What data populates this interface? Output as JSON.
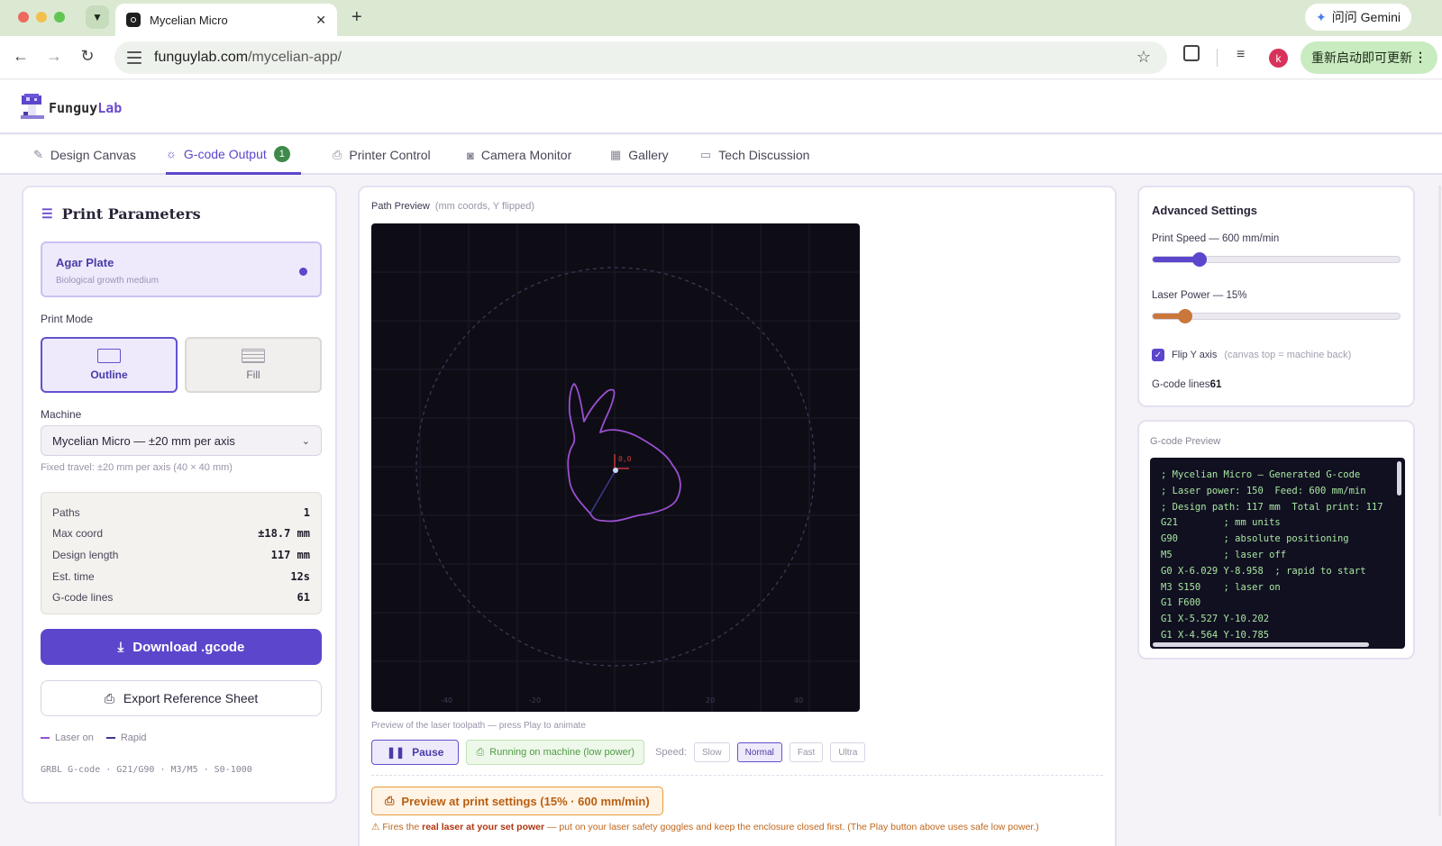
{
  "browser": {
    "tab_title": "Mycelian Micro",
    "url_host": "funguylab.com",
    "url_path": "/mycelian-app/",
    "gemini_label": "问问 Gemini",
    "avatar_letter": "k",
    "update_label": "重新启动即可更新"
  },
  "app": {
    "logo_main": "Funguy",
    "logo_accent": "Lab",
    "tabs": [
      {
        "label": "Design Canvas",
        "icon": "pencil-icon"
      },
      {
        "label": "G-code Output",
        "icon": "sun-icon",
        "badge": "1"
      },
      {
        "label": "Printer Control",
        "icon": "printer-icon"
      },
      {
        "label": "Camera Monitor",
        "icon": "camera-icon"
      },
      {
        "label": "Gallery",
        "icon": "grid-icon"
      },
      {
        "label": "Tech Discussion",
        "icon": "chat-icon"
      }
    ]
  },
  "params": {
    "title": "Print Parameters",
    "material_name": "Agar Plate",
    "material_sub": "Biological growth medium",
    "print_mode_label": "Print Mode",
    "mode_outline": "Outline",
    "mode_fill": "Fill",
    "machine_label": "Machine",
    "machine_value": "Mycelian Micro — ±20 mm per axis",
    "fixed_travel": "Fixed travel: ±20 mm per axis (40 × 40 mm)",
    "stats": [
      {
        "label": "Paths",
        "value": "1",
        "unit": ""
      },
      {
        "label": "Max coord",
        "value": "±18.7",
        "unit": "mm"
      },
      {
        "label": "Design length",
        "value": "117",
        "unit": "mm"
      },
      {
        "label": "Est. time",
        "value": "12s",
        "unit": ""
      },
      {
        "label": "G-code lines",
        "value": "61",
        "unit": ""
      }
    ],
    "download_label": "Download .gcode",
    "export_label": "Export Reference Sheet",
    "legend_laser": "Laser on",
    "legend_rapid": "Rapid",
    "footer": "GRBL G-code · G21/G90 · M3/M5 · S0-1000"
  },
  "preview": {
    "heading": "Path Preview",
    "heading_sub": "(mm coords, Y flipped)",
    "origin_label": "0,0",
    "axis_ticks": [
      "-40",
      "-20",
      "20",
      "40"
    ],
    "caption": "Preview of the laser toolpath — press Play to animate",
    "pause_label": "Pause",
    "running_label": "Running on machine (low power)",
    "speed_label": "Speed:",
    "speed_options": [
      "Slow",
      "Normal",
      "Fast",
      "Ultra"
    ],
    "speed_selected": "Normal",
    "print_preview_label": "Preview at print settings (15% · 600 mm/min)",
    "warning_pre": "Fires the ",
    "warning_bold": "real laser at your set power",
    "warning_post": " — put on your laser safety goggles and keep the enclosure closed first. (The Play button above uses safe low power.)"
  },
  "advanced": {
    "title": "Advanced Settings",
    "speed_label": "Print Speed — 600 mm/min",
    "speed_fraction": 0.19,
    "power_label": "Laser Power — 15%",
    "power_fraction": 0.13,
    "flip_label": "Flip Y axis",
    "flip_hint": "(canvas top = machine back)",
    "flip_checked": true,
    "gcode_lines_label": "G-code lines",
    "gcode_lines_value": "61"
  },
  "gcode": {
    "title": "G-code Preview",
    "lines": [
      "; Mycelian Micro — Generated G-code",
      "; Laser power: 150  Feed: 600 mm/min",
      "; Design path: 117 mm  Total print: 117",
      "G21        ; mm units",
      "G90        ; absolute positioning",
      "M5         ; laser off",
      "G0 X-6.029 Y-8.958  ; rapid to start",
      "M3 S150    ; laser on",
      "G1 F600",
      "G1 X-5.527 Y-10.202",
      "G1 X-4.564 Y-10.785"
    ]
  },
  "colors": {
    "accent": "#5b46cc",
    "laser_path": "#9b4fd0",
    "rapid_path": "#3b3a8a",
    "warning": "#c0661c",
    "running_green": "#4e9a45",
    "power_slider": "#c9773a"
  }
}
